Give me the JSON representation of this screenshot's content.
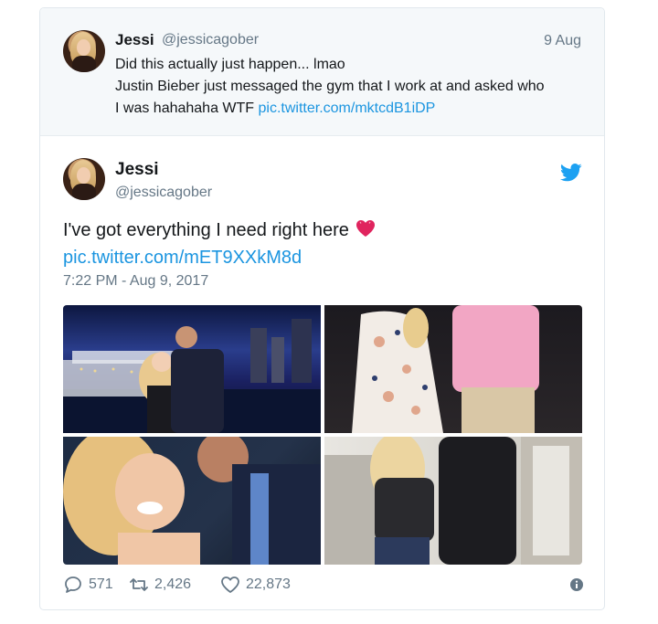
{
  "quoted": {
    "name": "Jessi",
    "handle": "@jessicagober",
    "date": "9 Aug",
    "line1": "Did this actually just happen... lmao",
    "line2": "Justin Bieber just messaged the gym that I work at and asked who",
    "line3_text": "I was hahahaha WTF ",
    "line3_link": "pic.twitter.com/mktcdB1iDP"
  },
  "tweet": {
    "name": "Jessi",
    "handle": "@jessicagober",
    "text": "I've got everything I need right here",
    "link": "pic.twitter.com/mET9XXkM8d",
    "timestamp": "7:22 PM - Aug 9, 2017"
  },
  "actions": {
    "replies": "571",
    "retweets": "2,426",
    "likes": "22,873"
  },
  "icons": {
    "bird": "twitter-bird-icon",
    "reply": "reply-icon",
    "retweet": "retweet-icon",
    "like": "heart-icon",
    "info": "info-icon",
    "emoji": "heart-emoji"
  },
  "colors": {
    "link": "#1b95e0",
    "muted": "#657786",
    "bird": "#1da1f2",
    "emoji": "#e0245e"
  }
}
